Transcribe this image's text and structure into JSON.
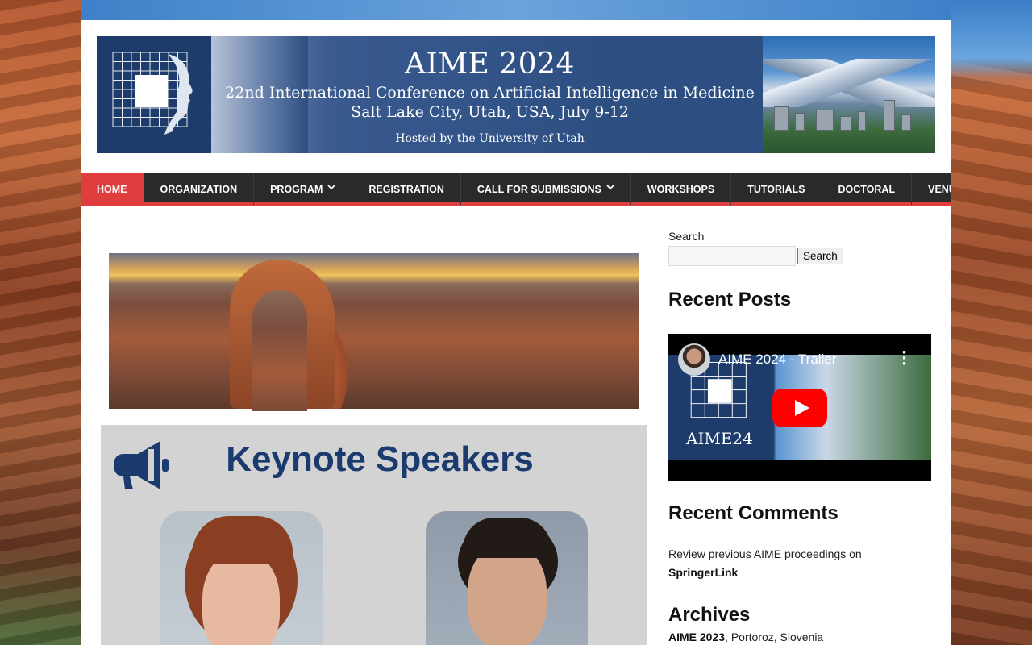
{
  "banner": {
    "title": "AIME 2024",
    "subtitle": "22nd International Conference on Artificial Intelligence in Medicine",
    "location": "Salt Lake City, Utah, USA, July 9-12",
    "host": "Hosted by the University of Utah"
  },
  "nav": {
    "items": [
      {
        "label": "HOME",
        "active": true,
        "dropdown": false
      },
      {
        "label": "ORGANIZATION",
        "active": false,
        "dropdown": false
      },
      {
        "label": "PROGRAM",
        "active": false,
        "dropdown": true
      },
      {
        "label": "REGISTRATION",
        "active": false,
        "dropdown": false
      },
      {
        "label": "CALL FOR SUBMISSIONS",
        "active": false,
        "dropdown": true
      },
      {
        "label": "WORKSHOPS",
        "active": false,
        "dropdown": false
      },
      {
        "label": "TUTORIALS",
        "active": false,
        "dropdown": false
      },
      {
        "label": "DOCTORAL",
        "active": false,
        "dropdown": false
      },
      {
        "label": "VENUE",
        "active": false,
        "dropdown": false
      }
    ]
  },
  "main": {
    "keynote_title": "Keynote Speakers"
  },
  "sidebar": {
    "search_label": "Search",
    "search_button": "Search",
    "recent_posts_title": "Recent Posts",
    "video": {
      "title": "AIME 2024 - Trailer",
      "thumb_label": "AIME24"
    },
    "recent_comments_title": "Recent Comments",
    "comment_text": "Review previous AIME proceedings on",
    "comment_link": "SpringerLink",
    "archives_title": "Archives",
    "archive_link": "AIME 2023",
    "archive_rest": ", Portoroz, Slovenia"
  },
  "colors": {
    "nav_bg": "#2a2a2a",
    "nav_active": "#e03e3e",
    "keynote_title": "#1b3a6e",
    "banner_bg": "#2d4f82"
  }
}
